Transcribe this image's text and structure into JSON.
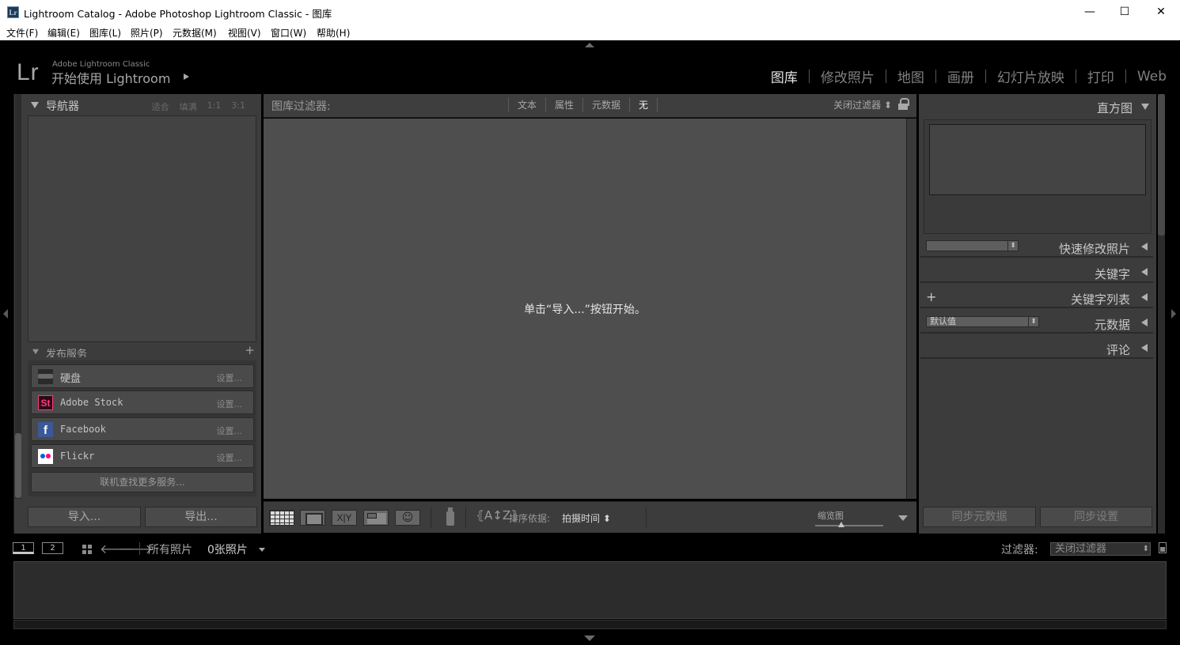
{
  "window": {
    "app_icon": "Lr",
    "title": "Lightroom Catalog - Adobe Photoshop Lightroom Classic - 图库",
    "min_glyph": "—",
    "max_glyph": "☐",
    "close_glyph": "✕"
  },
  "menubar": {
    "items": [
      "文件(F)",
      "编辑(E)",
      "图库(L)",
      "照片(P)",
      "元数据(M)",
      "视图(V)",
      "窗口(W)",
      "帮助(H)"
    ]
  },
  "identity_plate": {
    "logo": "Lr",
    "subtitle": "Adobe Lightroom Classic",
    "main": "开始使用 Lightroom"
  },
  "modules": [
    "图库",
    "修改照片",
    "地图",
    "画册",
    "幻灯片放映",
    "打印",
    "Web"
  ],
  "active_module": "图库",
  "navigator": {
    "title": "导航器",
    "options": [
      "适合",
      "填满",
      "1:1",
      "3:1"
    ]
  },
  "publish": {
    "title": "发布服务",
    "plus": "+",
    "services": [
      {
        "label": "硬盘",
        "setup": "设置..."
      },
      {
        "label": "Adobe Stock",
        "icon_text": "St",
        "setup": "设置..."
      },
      {
        "label": "Facebook",
        "icon_text": "f",
        "setup": "设置..."
      },
      {
        "label": "Flickr",
        "setup": "设置..."
      }
    ],
    "find_more": "联机查找更多服务..."
  },
  "left_buttons": {
    "import": "导入...",
    "export": "导出..."
  },
  "filter_bar": {
    "title": "图库过滤器:",
    "tabs": [
      "文本",
      "属性",
      "元数据",
      "无"
    ],
    "active_tab": "无",
    "preset": "关闭过滤器 ⬍"
  },
  "grid": {
    "empty_message": "单击“导入...”按钮开始。"
  },
  "toolbar": {
    "compare_label": "X|Y",
    "people_glyph": "☺",
    "sort_icon": "⦃A↕Z⦄",
    "sort_label": "排序依据:",
    "sort_value": "拍摄时间 ⬍",
    "thumb_label": "缩览图"
  },
  "right_panel": {
    "histogram": "直方图",
    "quick_develop": "快速修改照片",
    "keywording": "关键字",
    "keyword_list": "关键字列表",
    "keyword_plus": "+",
    "metadata": "元数据",
    "metadata_preset": "默认值",
    "quick_develop_preset": "",
    "comments": "评论",
    "sync_metadata": "同步元数据",
    "sync_settings": "同步设置"
  },
  "filmstrip": {
    "monitor1": "1",
    "monitor2": "2",
    "prev": "🡐",
    "next": "🡒",
    "source": "所有照片",
    "count": "0张照片",
    "filter_label": "过滤器:",
    "filter_value": "关闭过滤器"
  }
}
